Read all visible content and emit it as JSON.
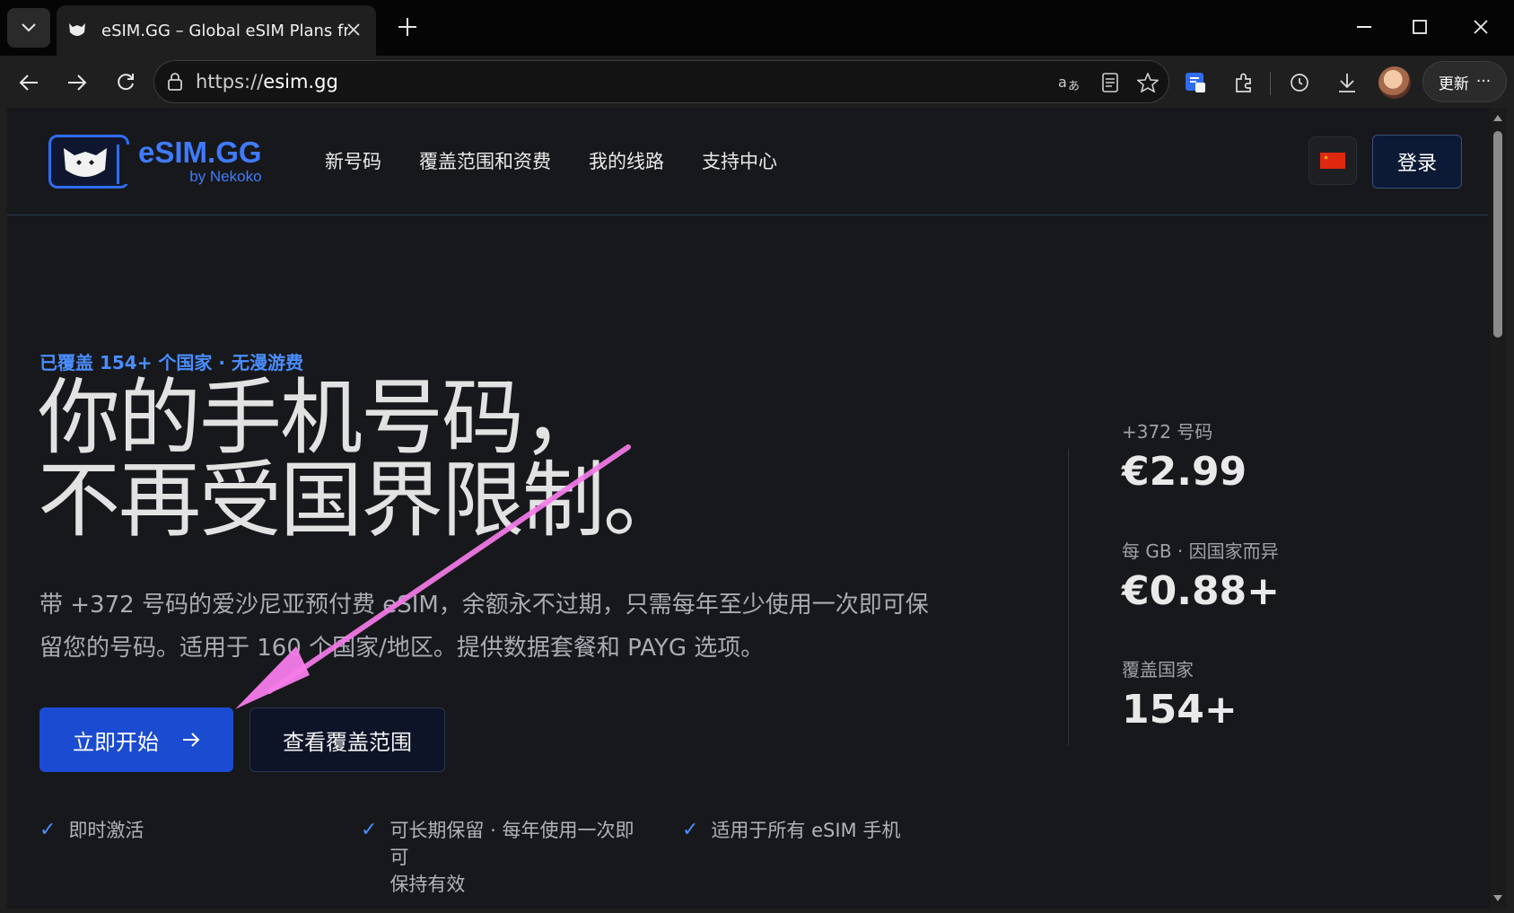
{
  "browser": {
    "tab_title": "eSIM.GG – Global eSIM Plans from",
    "url_scheme": "https://",
    "url_host": "esim.gg",
    "update_label": "更新"
  },
  "site": {
    "logo_name": "eSIM.GG",
    "logo_by": "by Nekoko",
    "nav": [
      "新号码",
      "覆盖范围和资费",
      "我的线路",
      "支持中心"
    ],
    "login_label": "登录"
  },
  "hero": {
    "eyebrow": "已覆盖 154+ 个国家 · 无漫游费",
    "title_line1": "你的手机号码，",
    "title_line2": "不再受国界限制。",
    "desc_line1": "带 +372 号码的爱沙尼亚预付费 eSIM，余额永不过期，只需每年至少使用一次即可保",
    "desc_line2": "留您的号码。适用于 160 个国家/地区。提供数据套餐和 PAYG 选项。",
    "cta_primary": "立即开始",
    "cta_secondary": "查看覆盖范围"
  },
  "features": [
    {
      "text": "即时激活"
    },
    {
      "text": "可长期保留 · 每年使用一次即可\n保持有效"
    },
    {
      "text": "适用于所有 eSIM 手机"
    }
  ],
  "stats": [
    {
      "label": "+372 号码",
      "value": "€2.99"
    },
    {
      "label": "每 GB · 因国家而异",
      "value": "€0.88+"
    },
    {
      "label": "覆盖国家",
      "value": "154+"
    }
  ],
  "colors": {
    "accent": "#1a4bd1",
    "accent_text": "#4a8dff",
    "page_bg": "#17181b",
    "annotation": "#f57bea"
  }
}
